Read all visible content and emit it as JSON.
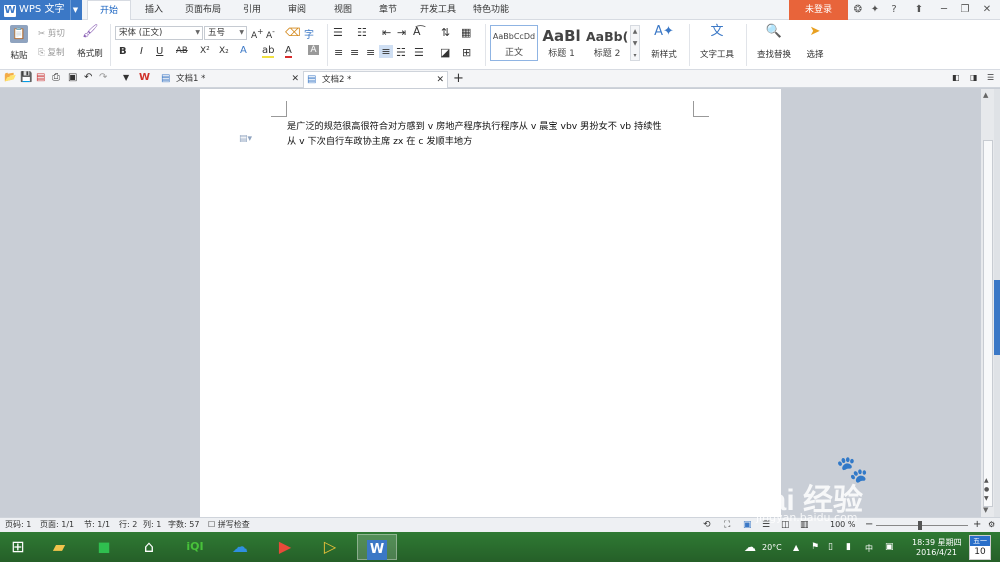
{
  "app": {
    "brand": "WPS 文字",
    "login": "未登录",
    "help": "?"
  },
  "menu_tabs": [
    {
      "label": "开始",
      "active": true
    },
    {
      "label": "插入"
    },
    {
      "label": "页面布局"
    },
    {
      "label": "引用"
    },
    {
      "label": "审阅"
    },
    {
      "label": "视图"
    },
    {
      "label": "章节"
    },
    {
      "label": "开发工具"
    },
    {
      "label": "特色功能"
    }
  ],
  "ribbon": {
    "paste": "粘贴",
    "cut": "剪切",
    "copy": "复制",
    "format_painter": "格式刷",
    "font_name": "宋体 (正文)",
    "font_size": "五号",
    "bold": "B",
    "italic": "I",
    "underline": "U",
    "strike": "AB",
    "superscript": "X²",
    "subscript": "X₂",
    "styles": [
      {
        "preview": "AaBbCcDd",
        "label": "正文"
      },
      {
        "preview": "AaBl",
        "label": "标题 1"
      },
      {
        "preview": "AaBb(",
        "label": "标题 2"
      }
    ],
    "new_style": "新样式",
    "text_tools": "文字工具",
    "find_replace": "查找替换",
    "select": "选择"
  },
  "doc_tabs": [
    {
      "label": "文档1 *",
      "active": false
    },
    {
      "label": "文档2 *",
      "active": true
    }
  ],
  "document": {
    "line1": "是广泛的规范很高很符合对方感到 v 房地产程序执行程序从 v 晨宝 vbv 男扮女不 vb 持续性",
    "line2": "从 v 下次自行车政协主席 zx 在 c 发顺丰地方"
  },
  "status": {
    "page": "页码: 1",
    "pages": "页面: 1/1",
    "section": "节: 1/1",
    "row": "行: 2",
    "col": "列: 1",
    "words": "字数: 57",
    "spell": "拼写检查",
    "zoom": "100 %"
  },
  "taskbar": {
    "weather": "20°C",
    "ime": "中",
    "time": "18:39 星期四",
    "date": "2016/4/21",
    "cal_day_label": "五一",
    "cal_day": "10"
  },
  "watermark": {
    "text": "Bai  经验",
    "url": "jingyan.baidu.com"
  },
  "colors": {
    "accent": "#3b78c6",
    "login": "#e8643a",
    "taskbar": "#2a6b2e"
  }
}
